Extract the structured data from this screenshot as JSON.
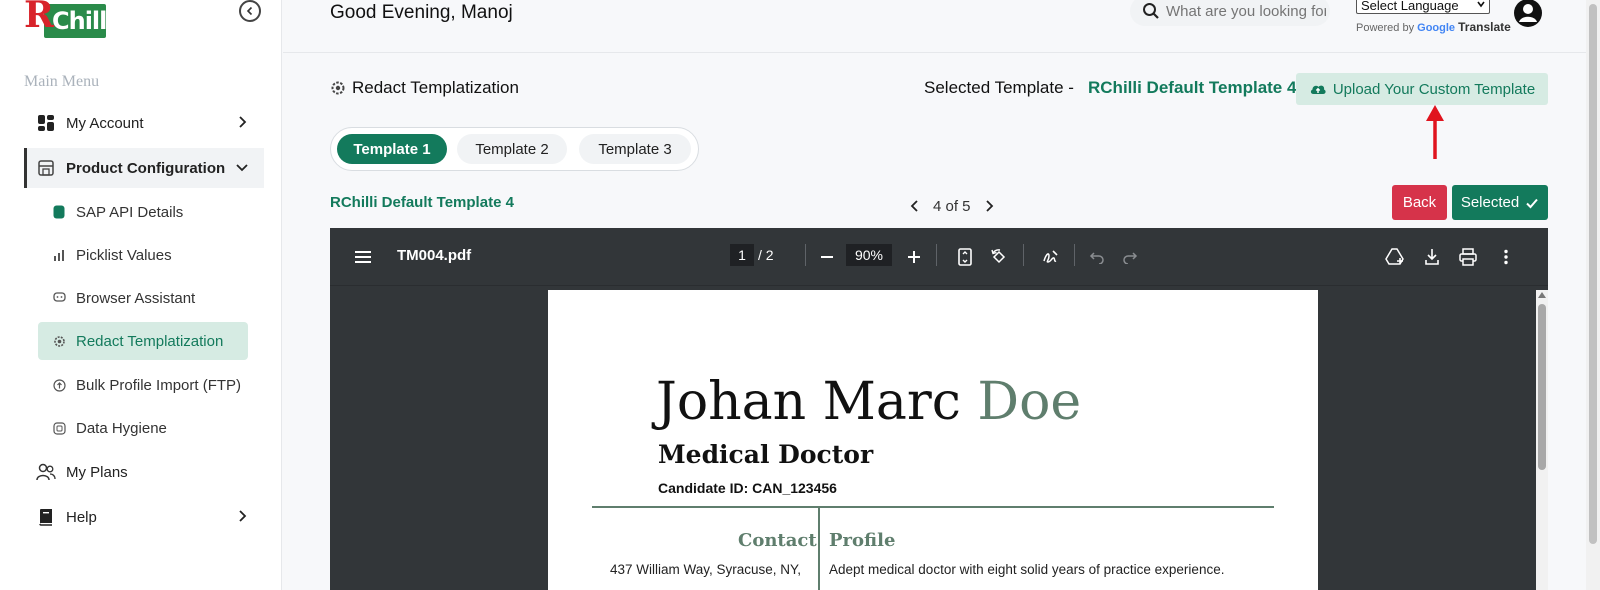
{
  "brand": {
    "logo_letter": "R",
    "logo_text": "Chilli"
  },
  "sidebar": {
    "menu_title": "Main Menu",
    "items": [
      {
        "label": "My Account",
        "icon": "account-grid-icon"
      },
      {
        "label": "Product Configuration",
        "icon": "store-icon"
      },
      {
        "label": "SAP API Details",
        "icon": "database-icon"
      },
      {
        "label": "Picklist Values",
        "icon": "bar-chart-icon"
      },
      {
        "label": "Browser Assistant",
        "icon": "chat-bubble-icon"
      },
      {
        "label": "Redact Templatization",
        "icon": "gear-icon"
      },
      {
        "label": "Bulk Profile Import (FTP)",
        "icon": "upload-circle-icon"
      },
      {
        "label": "Data Hygiene",
        "icon": "database-clean-icon"
      },
      {
        "label": "My Plans",
        "icon": "users-icon"
      },
      {
        "label": "Help",
        "icon": "book-icon"
      }
    ]
  },
  "header": {
    "greeting": "Good Evening, Manoj",
    "search_placeholder": "What are you looking for?",
    "language_select": "Select Language",
    "powered_by": "Powered by",
    "google": "Google",
    "translate": "Translate"
  },
  "page": {
    "title": "Redact Templatization",
    "selected_template_label": "Selected Template -",
    "selected_template_name": "RChilli Default Template 4",
    "upload_button": "Upload Your Custom Template",
    "tabs": [
      "Template 1",
      "Template 2",
      "Template 3"
    ],
    "active_tab": 0,
    "template_label": "RChilli Default Template 4",
    "pager": "4 of 5",
    "back_button": "Back",
    "selected_button": "Selected"
  },
  "pdf_viewer": {
    "file_name": "TM004.pdf",
    "current_page": "1",
    "total_pages": "/  2",
    "zoom": "90%",
    "document": {
      "first_names": "Johan Marc",
      "last_name": "Doe",
      "role": "Medical Doctor",
      "candidate_id": "Candidate ID: CAN_123456",
      "contact_heading": "Contact",
      "profile_heading": "Profile",
      "contact_text": "437 William Way, Syracuse, NY,",
      "profile_text": "Adept medical doctor with eight solid years of practice experience."
    }
  },
  "colors": {
    "accent": "#137a5c",
    "accent_light": "#d6ebe3",
    "danger": "#d6334a",
    "pdf_toolbar": "#323639",
    "doc_green": "#5f7e6d"
  }
}
